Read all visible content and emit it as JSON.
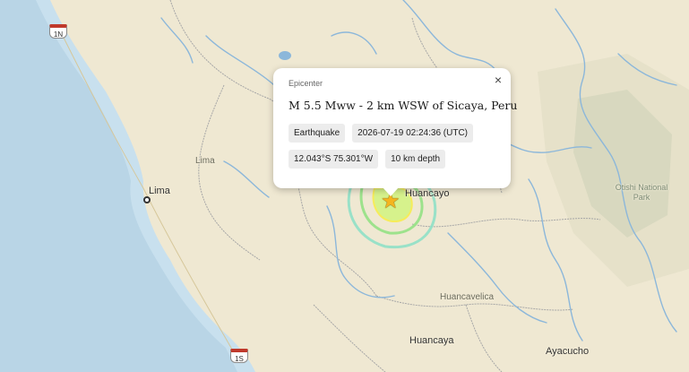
{
  "popup": {
    "header": "Epicenter",
    "close_glyph": "×",
    "title": "M 5.5 Mww - 2 km WSW of Sicaya, Peru",
    "event_type": "Earthquake",
    "time": "2026-07-19 02:24:36 (UTC)",
    "coordinates": "12.043°S 75.301°W",
    "depth": "10 km depth"
  },
  "places": {
    "lima_region": "Lima",
    "lima_city": "Lima",
    "huancayo": "Huancayo",
    "huancavelica_region": "Huancavelica",
    "huancavelica_city": "Huancaya",
    "ayacucho": "Ayacucho",
    "park": "Otishi National Park"
  },
  "shields": {
    "top": "1N",
    "bottom": "1S"
  },
  "icons": {
    "epicenter": "star-icon",
    "close": "close-icon",
    "city": "city-dot-icon"
  },
  "colors": {
    "land": "#efe8d2",
    "ocean": "#b9d5e6",
    "river": "#8cb7da",
    "border": "#a7a7a7",
    "epicenter_star": "#f4b51f",
    "intensity_inner": "#f6ec5a",
    "intensity_mid": "#9de28c",
    "intensity_outer": "#8fe0c7"
  }
}
